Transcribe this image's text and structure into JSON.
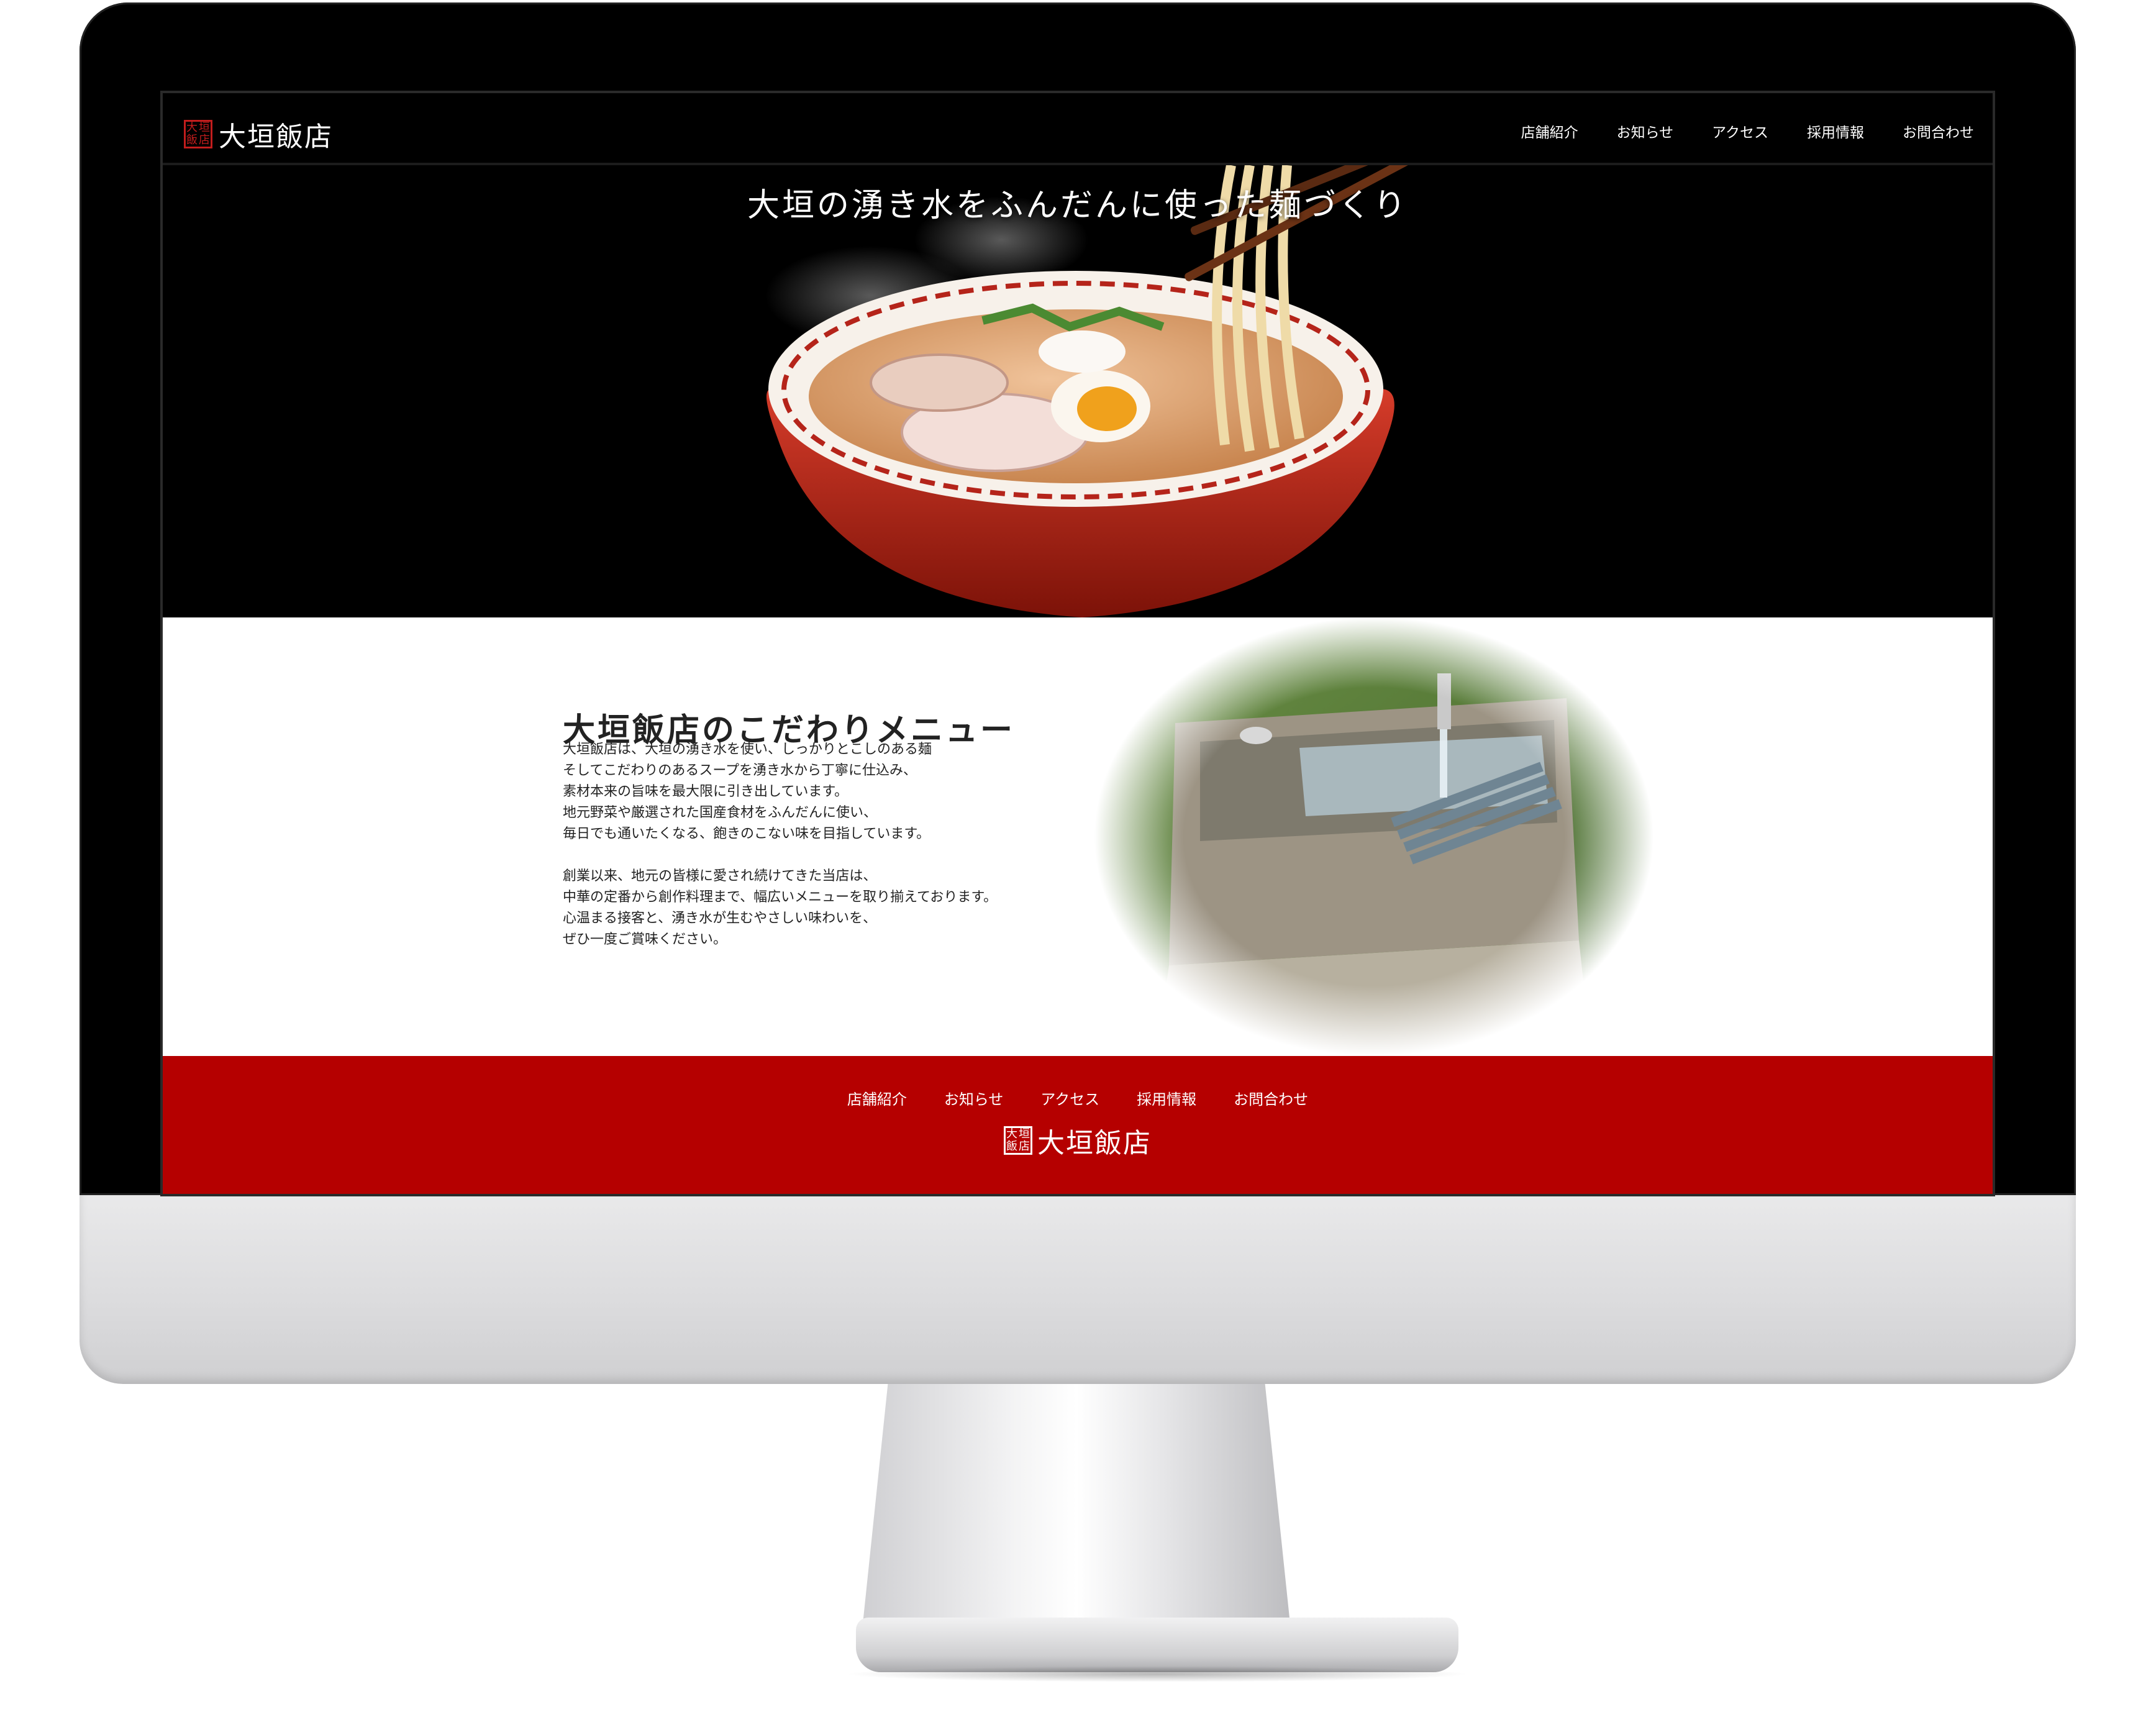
{
  "site": {
    "logo_seal_chars": [
      "大",
      "垣",
      "飯",
      "店"
    ],
    "logo_name": "大垣飯店"
  },
  "header": {
    "nav": [
      "店舗紹介",
      "お知らせ",
      "アクセス",
      "採用情報",
      "お問合わせ"
    ]
  },
  "hero": {
    "title": "大垣の湧き水をふんだんに使った麺づくり"
  },
  "intro": {
    "title": "大垣飯店のこだわりメニュー",
    "paragraph1": "大垣飯店は、大垣の湧き水を使い、しっかりとこしのある麺\nそしてこだわりのあるスープを湧き水から丁寧に仕込み、\n素材本来の旨味を最大限に引き出しています。\n地元野菜や厳選された国産食材をふんだんに使い、\n毎日でも通いたくなる、飽きのこない味を目指しています。",
    "paragraph2": "創業以来、地元の皆様に愛され続けてきた当店は、\n中華の定番から創作料理まで、幅広いメニューを取り揃えております。\n心温まる接客と、湧き水が生むやさしい味わいを、\nぜひ一度ご賞味ください。"
  },
  "footer": {
    "nav": [
      "店舗紹介",
      "お知らせ",
      "アクセス",
      "採用情報",
      "お問合わせ"
    ],
    "logo_name": "大垣飯店"
  },
  "colors": {
    "brand_red": "#b50000",
    "seal_red": "#c21d1d",
    "header_bg": "#000000"
  }
}
